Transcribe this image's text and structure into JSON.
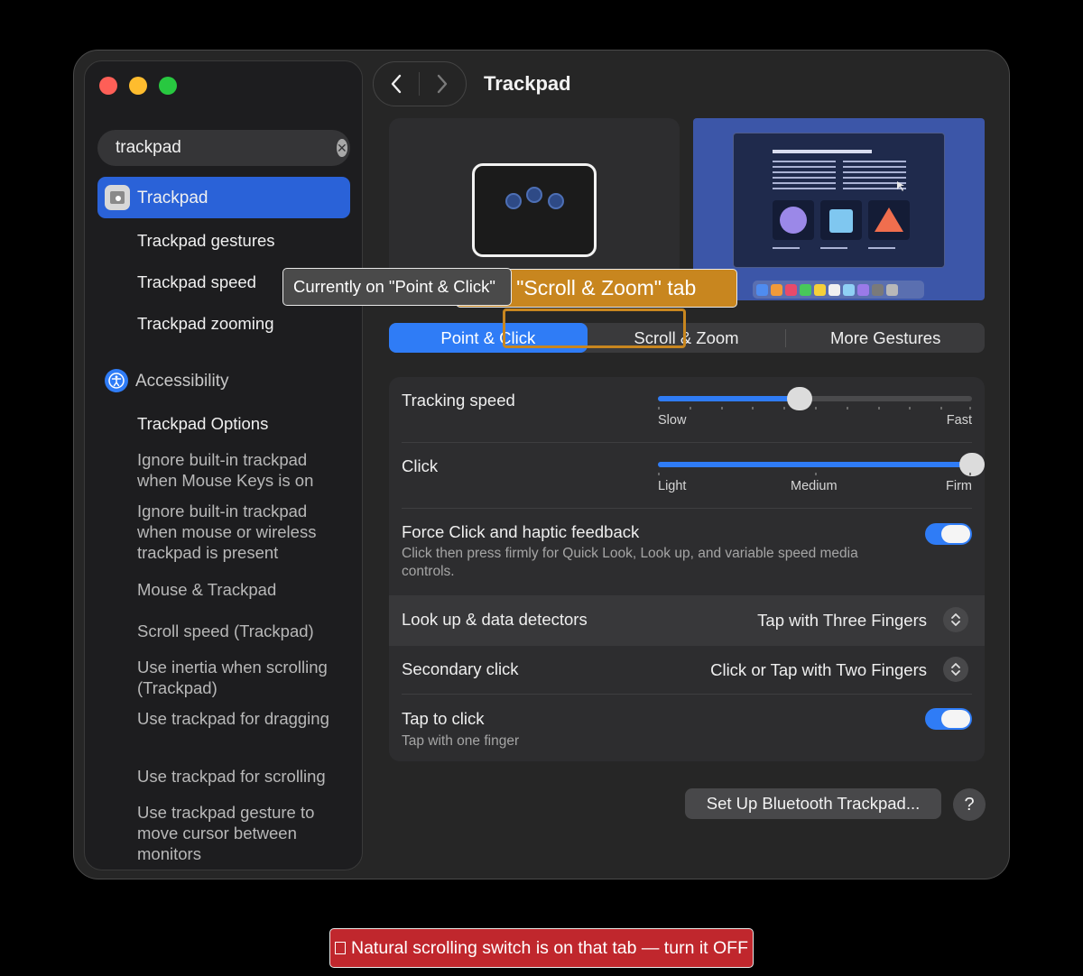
{
  "window": {
    "title": "Trackpad"
  },
  "search": {
    "value": "trackpad"
  },
  "sidebar": {
    "trackpad": "Trackpad",
    "trackpad_subs": [
      "Trackpad gestures",
      "Trackpad speed",
      "Trackpad zooming"
    ],
    "accessibility": "Accessibility",
    "access_subs": [
      "Trackpad Options",
      "Ignore built-in trackpad when Mouse Keys is on",
      "Ignore built-in trackpad when mouse or wireless trackpad is present",
      "Mouse & Trackpad",
      "Scroll speed (Trackpad)",
      "Use inertia when scrolling (Trackpad)",
      "Use trackpad for dragging",
      "Use trackpad for scrolling",
      "Use trackpad gesture to move cursor between monitors"
    ]
  },
  "tabs": [
    "Point & Click",
    "Scroll & Zoom",
    "More Gestures"
  ],
  "settings": {
    "tracking_speed": {
      "label": "Tracking speed",
      "min": "Slow",
      "max": "Fast",
      "value": 0.45
    },
    "click": {
      "label": "Click",
      "light": "Light",
      "medium": "Medium",
      "firm": "Firm",
      "value": 1.0
    },
    "force_click": {
      "label": "Force Click and haptic feedback",
      "desc": "Click then press firmly for Quick Look, Look up, and variable speed media controls.",
      "on": true
    },
    "lookup": {
      "label": "Look up & data detectors",
      "value": "Tap with Three Fingers"
    },
    "secondary": {
      "label": "Secondary click",
      "value": "Click or Tap with Two Fingers"
    },
    "tap": {
      "label": "Tap to click",
      "desc": "Tap with one finger",
      "on": true
    }
  },
  "buttons": {
    "bluetooth": "Set Up Bluetooth Trackpad...",
    "help": "?"
  },
  "overlays": {
    "instruction": "Click \"Scroll & Zoom\" tab",
    "current": "Currently on \"Point & Click\"",
    "hint": "Natural scrolling switch is on that tab — turn it OFF"
  },
  "colors": {
    "accent": "#2f7cf6",
    "selected": "#2a62d8",
    "overlay_orange": "#c8861f",
    "overlay_red": "#c0272d"
  }
}
